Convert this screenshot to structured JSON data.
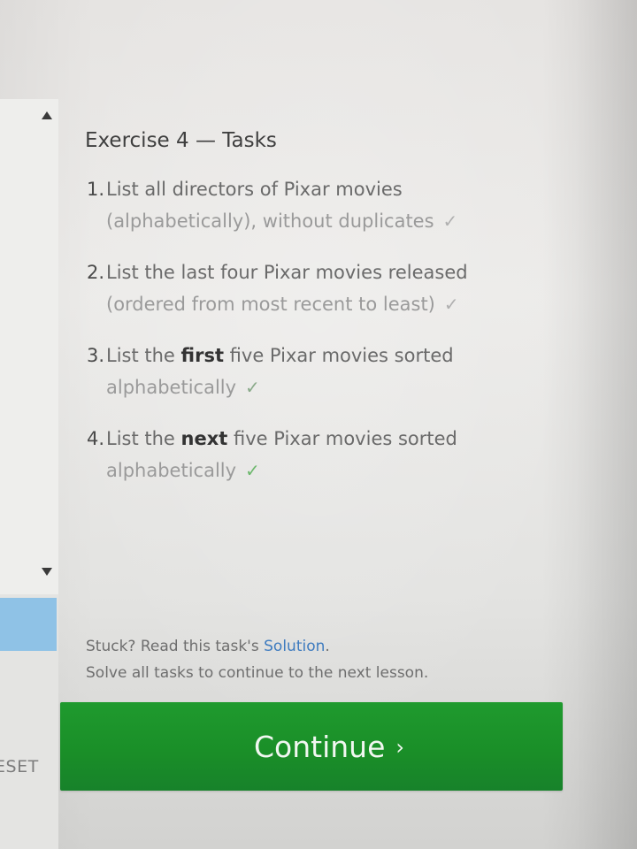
{
  "exercise": {
    "title": "Exercise 4 — Tasks"
  },
  "tasks": [
    {
      "number": "1.",
      "line1_pre": "List all directors of Pixar movies",
      "line1_bold": "",
      "line1_post": "",
      "line2": "(alphabetically), without duplicates",
      "check": "✓",
      "check_color": "#b0b0b0"
    },
    {
      "number": "2.",
      "line1_pre": "List the last four Pixar movies released",
      "line1_bold": "",
      "line1_post": "",
      "line2": "(ordered from most recent to least)",
      "check": "✓",
      "check_color": "#b0b0b0"
    },
    {
      "number": "3.",
      "line1_pre": "List the ",
      "line1_bold": "first",
      "line1_post": " five Pixar movies sorted",
      "line2": "alphabetically",
      "check": "✓",
      "check_color": "#8aaa8a"
    },
    {
      "number": "4.",
      "line1_pre": "List the ",
      "line1_bold": "next",
      "line1_post": " five Pixar movies sorted",
      "line2": "alphabetically",
      "check": "✓",
      "check_color": "#6db86d"
    }
  ],
  "footer": {
    "stuck_prefix": "Stuck? Read this task's ",
    "solution_link": "Solution",
    "stuck_suffix": ".",
    "instruction": "Solve all tasks to continue to the next lesson."
  },
  "continue_button": {
    "label": "Continue",
    "chevron": "›",
    "color": "#1a8f28"
  },
  "left_panel": {
    "reset_label": "ESET"
  },
  "icons": {
    "scroll_up": "scroll-up-arrow-icon",
    "scroll_down": "scroll-down-arrow-icon",
    "check": "checkmark-icon"
  }
}
